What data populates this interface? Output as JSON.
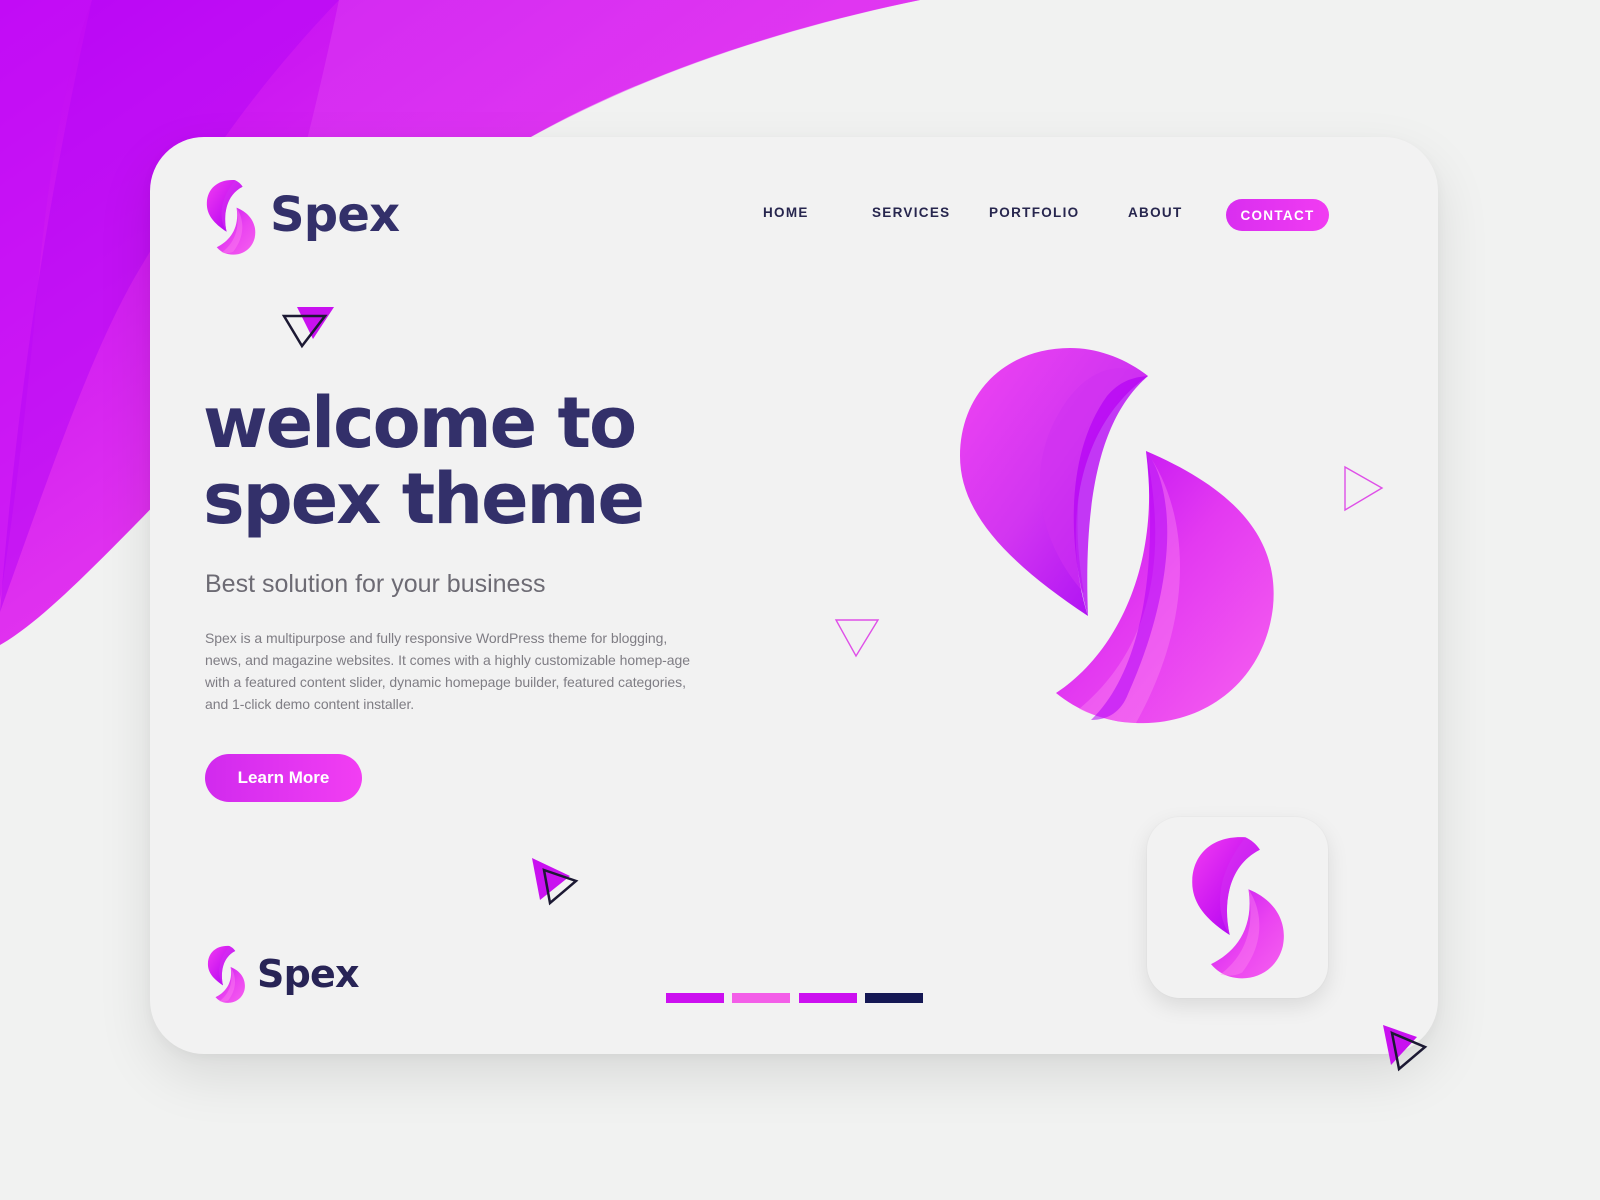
{
  "page": {
    "background_color": "#f1f2f1"
  },
  "brand": {
    "name": "Spex",
    "icon_name": "spex-logo-icon",
    "accent_colors": [
      "#e333ef",
      "#be24f2",
      "#f35ef1",
      "#33306a"
    ]
  },
  "navigation": {
    "items": [
      {
        "label": "HOME"
      },
      {
        "label": "SERVICES"
      },
      {
        "label": "PORTFOLIO"
      },
      {
        "label": "ABOUT"
      }
    ],
    "contact_label": "CONTACT"
  },
  "hero": {
    "title_line_1": "welcome to",
    "title_line_2": "spex theme",
    "subtitle": "Best solution for your business",
    "description": "Spex is a multipurpose and fully responsive WordPress theme for blogging, news, and magazine websites. It comes with a highly customizable homep-age with a featured content slider, dynamic homepage builder, featured categories, and 1-click demo content installer.",
    "button_label": "Learn More",
    "illustration_name": "large-spex-symbol"
  },
  "footer": {
    "brand_name": "Spex",
    "icon_name": "spex-logo-icon"
  },
  "palette": {
    "swatches": [
      "#cc10f0",
      "#f35ee8",
      "#cc10f0",
      "#151854"
    ]
  },
  "app_icon": {
    "name": "spex-app-icon"
  },
  "decorations": {
    "icon_name": "triangle-decoration-icon"
  }
}
